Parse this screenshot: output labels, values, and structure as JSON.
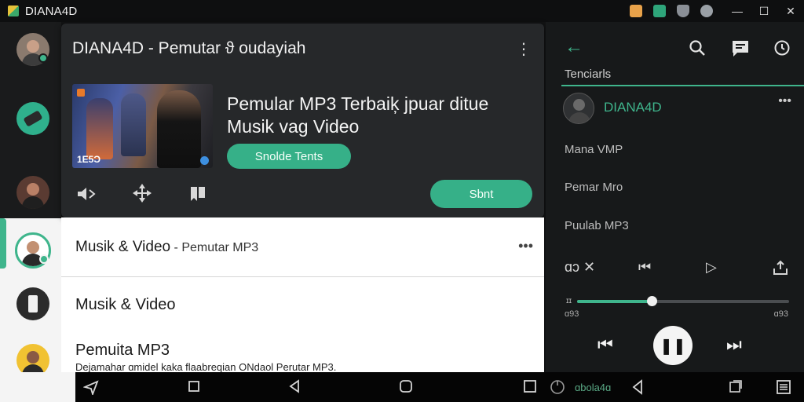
{
  "window": {
    "title": "DIANA4D",
    "controls": {
      "minimize": "—",
      "maximize": "☐",
      "close": "✕"
    },
    "tray_icons": [
      "shop-icon",
      "app-icon",
      "shield-icon",
      "sync-icon"
    ]
  },
  "sidebar": {
    "items": [
      {
        "name": "contact-1",
        "badge": true
      },
      {
        "name": "contact-2-device"
      },
      {
        "name": "contact-3"
      },
      {
        "name": "contact-4-selected",
        "badge": true
      },
      {
        "name": "contact-5-device"
      },
      {
        "name": "contact-6"
      }
    ]
  },
  "card": {
    "title": "DIANA4D - Pemutar ϑ oudayiah",
    "more": "⋮",
    "thumbnail_label": "1E5Ɔ",
    "headline_line1": "Pemular MP3 Terbaiķ jpuar ditue",
    "headline_line2": "Musik vag Video",
    "green_button": "Snolde Tents",
    "start_button": "Sbnt",
    "icons": [
      "volume-icon",
      "move-icon",
      "bookmark-icon"
    ]
  },
  "list": {
    "row1_title": "Musik & Video",
    "row1_suffix": " - Pemutar MP3",
    "row1_more": "•••",
    "row2_title": "Musik & Video",
    "row3_title": "Pemuita MP3",
    "row3_sub": "Dejamahar ɑmidel kaka flaabreqian ONdaol Perutar MP3."
  },
  "player": {
    "back": "←",
    "tab": "Tenciarls",
    "name": "DIANA4D",
    "more": "•••",
    "items": [
      "Mana VMP",
      "Pemar Mro",
      "Puulab MP3"
    ],
    "controls_row": [
      "ɑɔ",
      "✕",
      "⏮",
      "▷",
      "share"
    ],
    "progress": 0.35,
    "progress_start_mark": "ɪɪ",
    "elapsed": "ɑ93",
    "total": "ɑ93",
    "prev": "⏮",
    "pause": "❚❚",
    "next": "⏭"
  },
  "navbar": {
    "label": "ɑbola4ɑ",
    "icons": [
      "send-icon",
      "square-icon",
      "back-triangle-icon",
      "home-icon",
      "recents-icon",
      "power-icon",
      "back-icon",
      "window-icon",
      "menu-icon"
    ]
  },
  "colors": {
    "accent": "#36b088",
    "dark": "#26282a",
    "panel": "#17191a"
  }
}
